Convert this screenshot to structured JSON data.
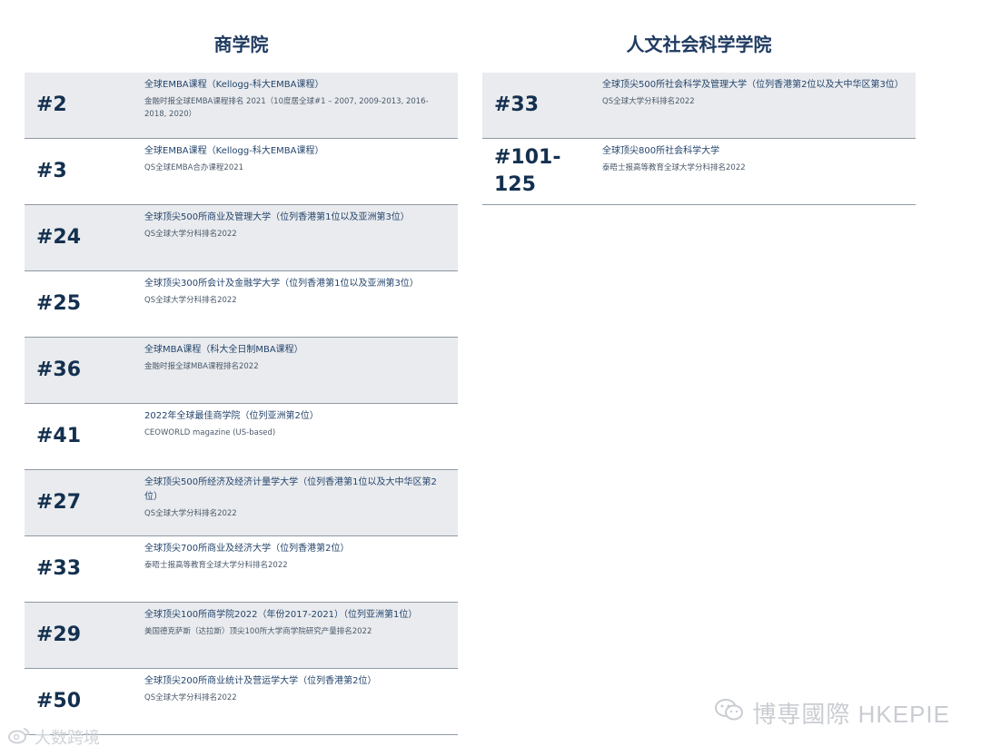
{
  "business_school": {
    "heading": "商学院",
    "rows": [
      {
        "rank": "#2",
        "title": "全球EMBA课程（Kellogg-科大EMBA课程）",
        "source": "金融时报全球EMBA课程排名 2021（10度居全球#1 – 2007, 2009-2013, 2016-2018, 2020）"
      },
      {
        "rank": "#3",
        "title": "全球EMBA课程（Kellogg-科大EMBA课程）",
        "source": "QS全球EMBA合办课程2021"
      },
      {
        "rank": "#24",
        "title": "全球顶尖500所商业及管理大学（位列香港第1位以及亚洲第3位）",
        "source": "QS全球大学分科排名2022"
      },
      {
        "rank": "#25",
        "title": "全球顶尖300所会计及金融学大学（位列香港第1位以及亚洲第3位）",
        "source": "QS全球大学分科排名2022"
      },
      {
        "rank": "#36",
        "title": "全球MBA课程（科大全日制MBA课程）",
        "source": "金融时报全球MBA课程排名2022"
      },
      {
        "rank": "#41",
        "title": "2022年全球最佳商学院（位列亚洲第2位）",
        "source": "CEOWORLD magazine (US-based)"
      },
      {
        "rank": "#27",
        "title": "全球顶尖500所经济及经济计量学大学（位列香港第1位以及大中华区第2位）",
        "source": "QS全球大学分科排名2022"
      },
      {
        "rank": "#33",
        "title": "全球顶尖700所商业及经济大学（位列香港第2位）",
        "source": "泰晤士报高等教育全球大学分科排名2022"
      },
      {
        "rank": "#29",
        "title": "全球顶尖100所商学院2022（年份2017-2021）（位列亚洲第1位）",
        "source": "美国德克萨斯（达拉斯）顶尖100所大学商学院研究产量排名2022"
      },
      {
        "rank": "#50",
        "title": "全球顶尖200所商业统计及营运学大学（位列香港第2位）",
        "source": "QS全球大学分科排名2022"
      }
    ]
  },
  "humanities_school": {
    "heading": "人文社会科学学院",
    "rows": [
      {
        "rank": "#33",
        "title": "全球顶尖500所社会科学及管理大学（位列香港第2位以及大中华区第3位）",
        "source": "QS全球大学分科排名2022"
      },
      {
        "rank": "#101-125",
        "title": "全球顶尖800所社会科学大学",
        "source": "泰晤士报高等教育全球大学分科排名2022"
      }
    ]
  },
  "watermarks": {
    "right": "博専國際 HKEPIE",
    "left": "大数跨境",
    "right_icon": "wechat-icon",
    "left_icon": "weibo-icon"
  }
}
